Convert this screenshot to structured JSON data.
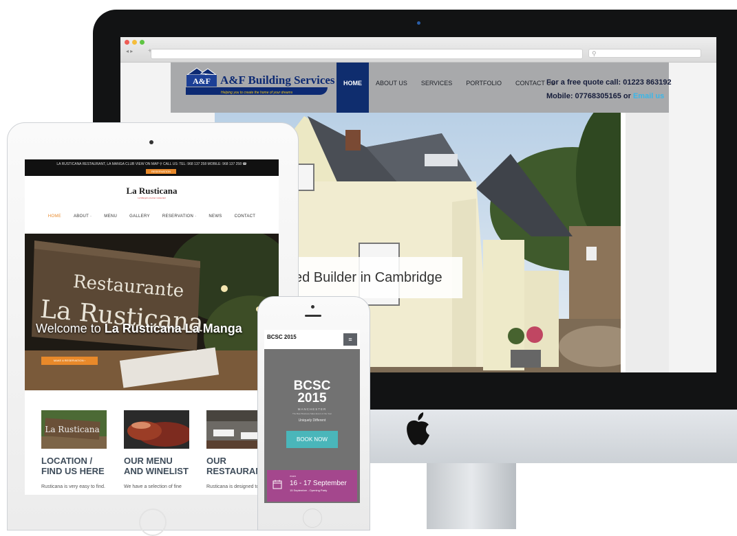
{
  "desktop_site": {
    "logo_name": "A&F Building Services Ltd",
    "logo_tagline": "Helping you to create the home of your dreams",
    "nav": [
      {
        "label": "HOME",
        "active": true
      },
      {
        "label": "ABOUT US",
        "active": false
      },
      {
        "label": "SERVICES",
        "active": false
      },
      {
        "label": "PORTFOLIO",
        "active": false
      },
      {
        "label": "CONTACT US",
        "active": false
      }
    ],
    "quote_line1": "For a free quote call: 01223 863192",
    "quote_line2_prefix": "Mobile: 07768305165 or",
    "quote_link": "Email us",
    "hero_caption": "ed Builder in Cambridge",
    "slider_dots": 3,
    "accent_color": "#0f2d6e"
  },
  "tablet_site": {
    "topbar_text": "LA RUSTICANA RESTAURANT, LA MANGA CLUB VIEW ON MAP ⚲   CALL US: TEL: 968 137 258 MOBILE: 968 137 258 ☎",
    "reserve_label": "RESERVATION",
    "logo": "La Rusticana",
    "logo_sub": "La Manga's premier restaurant",
    "nav": [
      {
        "label": "HOME",
        "active": true
      },
      {
        "label": "ABOUT ·",
        "active": false
      },
      {
        "label": "MENU",
        "active": false
      },
      {
        "label": "GALLERY",
        "active": false
      },
      {
        "label": "RESERVATION ·",
        "active": false
      },
      {
        "label": "NEWS",
        "active": false
      },
      {
        "label": "CONTACT",
        "active": false
      }
    ],
    "welcome_prefix": "Welcome to",
    "welcome_name": "La Rusticana La Manga",
    "hero_sign_line1": "Restaurante",
    "hero_sign_line2": "La Rusticana",
    "book_button": "MAKE A RESERVATION ›",
    "cards": [
      {
        "title1": "LOCATION /",
        "title2": "FIND US HERE",
        "desc": "Rusticana is very easy to find."
      },
      {
        "title1": "OUR MENU",
        "title2": "AND WINELIST",
        "desc": "We have a selection of fine"
      },
      {
        "title1": "OUR",
        "title2": "RESTAURANT",
        "desc": "Rusticana is designed to"
      }
    ],
    "card_sign": "La Rusticana",
    "accent_color": "#e8892a"
  },
  "phone_site": {
    "logo": "BCSC 2015",
    "menu_icon": "≡",
    "title_line1": "BCSC",
    "title_line2": "2015",
    "city": "MANCHESTER",
    "award": "The Best Business Sales Event of the Year",
    "tagline": "Uniquely Different",
    "book_button": "BOOK NOW",
    "event_when": "WHEN",
    "event_dates": "16 - 17 September",
    "event_party": "15 September - Opening Party",
    "accent_color": "#4ab6ba",
    "event_color": "#a4478d"
  }
}
